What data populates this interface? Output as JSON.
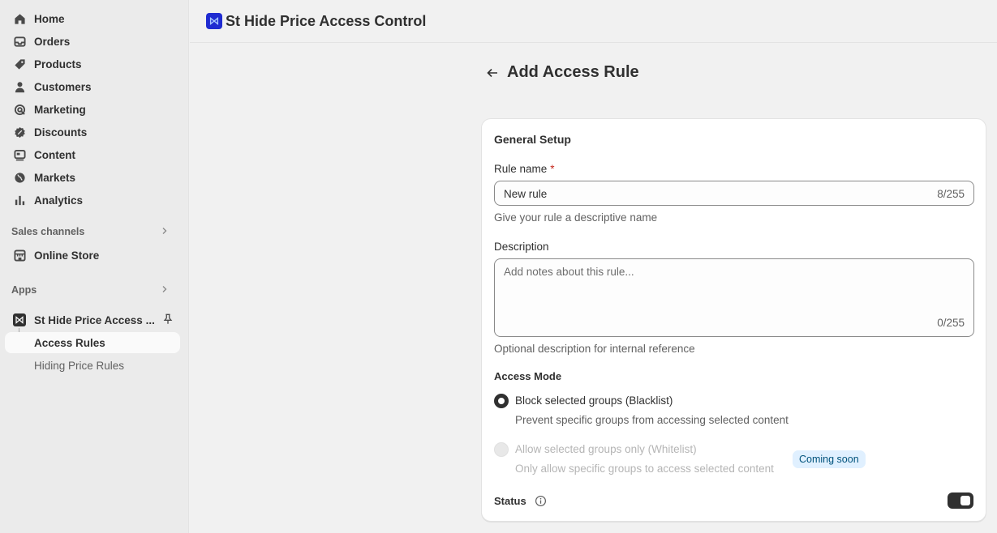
{
  "sidebar": {
    "nav": [
      {
        "label": "Home",
        "icon": "home-icon"
      },
      {
        "label": "Orders",
        "icon": "inbox-icon"
      },
      {
        "label": "Products",
        "icon": "tag-icon"
      },
      {
        "label": "Customers",
        "icon": "person-icon"
      },
      {
        "label": "Marketing",
        "icon": "target-icon"
      },
      {
        "label": "Discounts",
        "icon": "discount-icon"
      },
      {
        "label": "Content",
        "icon": "content-icon"
      },
      {
        "label": "Markets",
        "icon": "globe-icon"
      },
      {
        "label": "Analytics",
        "icon": "bar-chart-icon"
      }
    ],
    "sales_channels": {
      "label": "Sales channels",
      "items": [
        {
          "label": "Online Store",
          "icon": "store-icon"
        }
      ]
    },
    "apps": {
      "label": "Apps",
      "app_name": "St Hide Price Access ...",
      "sub_items": [
        {
          "label": "Access Rules",
          "active": true
        },
        {
          "label": "Hiding Price Rules",
          "active": false
        }
      ]
    }
  },
  "topbar": {
    "title": "St Hide Price Access Control"
  },
  "page": {
    "title": "Add Access Rule"
  },
  "form": {
    "section_title": "General Setup",
    "rule_name": {
      "label": "Rule name",
      "required_mark": "*",
      "value": "New rule",
      "counter": "8/255",
      "help": "Give your rule a descriptive name"
    },
    "description": {
      "label": "Description",
      "placeholder": "Add notes about this rule...",
      "counter": "0/255",
      "help": "Optional description for internal reference"
    },
    "access_mode": {
      "label": "Access Mode",
      "options": [
        {
          "label": "Block selected groups (Blacklist)",
          "help": "Prevent specific groups from accessing selected content",
          "selected": true,
          "disabled": false
        },
        {
          "label": "Allow selected groups only (Whitelist)",
          "help": "Only allow specific groups to access selected content",
          "selected": false,
          "disabled": true,
          "badge": "Coming soon"
        }
      ]
    },
    "status": {
      "label": "Status",
      "enabled": true
    }
  }
}
